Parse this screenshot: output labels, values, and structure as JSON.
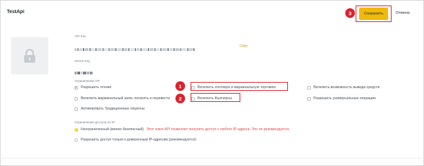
{
  "title": "TestApi",
  "api_key": {
    "label": "API Key",
    "copy_label": "Copy"
  },
  "secret_key": {
    "label": "Secret Key"
  },
  "restrictions": {
    "label": "Ограничения API",
    "enable_reading": "Разрешить чтение",
    "enable_margin_loan": "Включить маржинальный заем, погасить и перевести",
    "activate_options": "Активировать Традиционные опционы",
    "enable_spot_margin": "Включить спотовую и маржинальную торговлю",
    "enable_futures": "Включить Фьючерсы",
    "enable_withdrawals": "Включить возможность вывода средств",
    "permit_universal": "Разрешить универсальные операции"
  },
  "ip_access": {
    "label": "Ограничение доступа по IP:",
    "unrestricted": "Неограниченный (менее безопасный)",
    "unrestricted_warning": "Этот ключ API позволяет получить доступ с любого IP-адреса. Это не рекомендуется.",
    "trusted_only": "Разрешить доступ только к доверенным IP-адресам (рекомендуется)"
  },
  "actions": {
    "save": "Сохранить",
    "cancel": "Отмена"
  },
  "callouts": [
    "1",
    "2",
    "3"
  ],
  "colors": {
    "accent": "#f0b90b",
    "callout": "#d9232d",
    "warning": "#e84142"
  },
  "icons": {
    "avatar": "lock-icon"
  }
}
